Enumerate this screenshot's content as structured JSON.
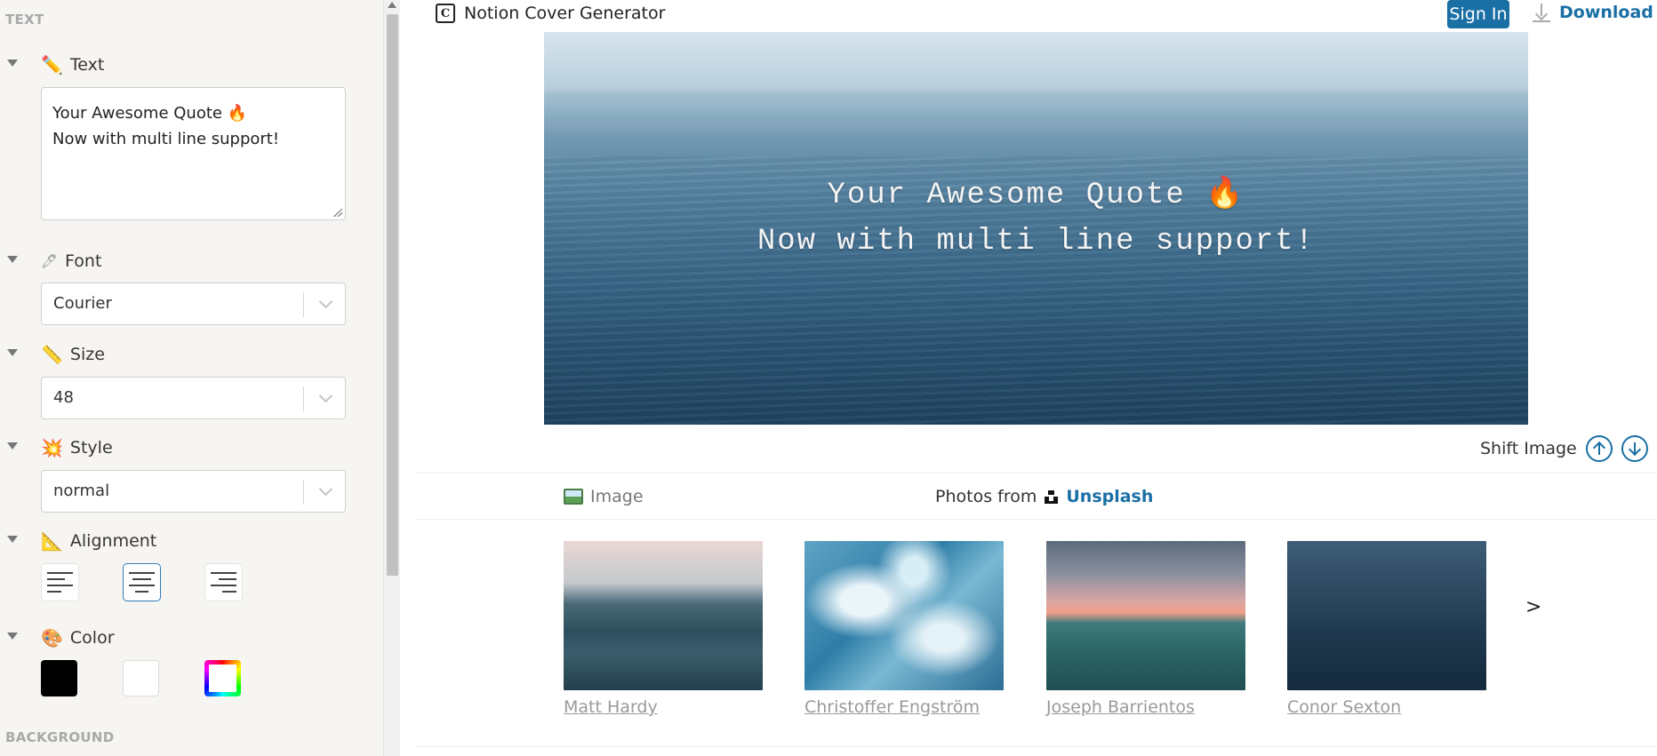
{
  "sidebar": {
    "section_text": "TEXT",
    "section_background": "BACKGROUND",
    "text_group": {
      "label": "Text",
      "icon": "pencil-icon",
      "value": "Your Awesome Quote 🔥\nNow with multi line support!"
    },
    "font_group": {
      "label": "Font",
      "icon": "pen-icon",
      "value": "Courier"
    },
    "size_group": {
      "label": "Size",
      "icon": "ruler-icon",
      "value": "48"
    },
    "style_group": {
      "label": "Style",
      "icon": "sparkle-icon",
      "value": "normal"
    },
    "alignment_group": {
      "label": "Alignment",
      "icon": "triangle-ruler-icon",
      "selected": "center",
      "options": [
        "left",
        "center",
        "right"
      ]
    },
    "color_group": {
      "label": "Color",
      "icon": "palette-icon",
      "swatches": [
        "#000000",
        "#ffffff",
        "rainbow"
      ]
    }
  },
  "header": {
    "app_title": "Notion Cover Generator",
    "sign_in_label": "Sign In",
    "download_label": "Download"
  },
  "cover": {
    "text": "Your Awesome Quote 🔥\nNow with multi line support!",
    "text_color": "#f4f4f4"
  },
  "shift": {
    "label": "Shift Image"
  },
  "image_panel": {
    "tab_label": "Image",
    "photos_from_label": "Photos from",
    "source_label": "Unsplash",
    "next_label": ">",
    "photos": [
      {
        "credit": "Matt Hardy"
      },
      {
        "credit": "Christoffer Engström"
      },
      {
        "credit": "Joseph Barrientos"
      },
      {
        "credit": "Conor Sexton"
      }
    ]
  },
  "colors": {
    "accent": "#1a6fa5",
    "sidebar_bg": "#f6f5f2"
  }
}
